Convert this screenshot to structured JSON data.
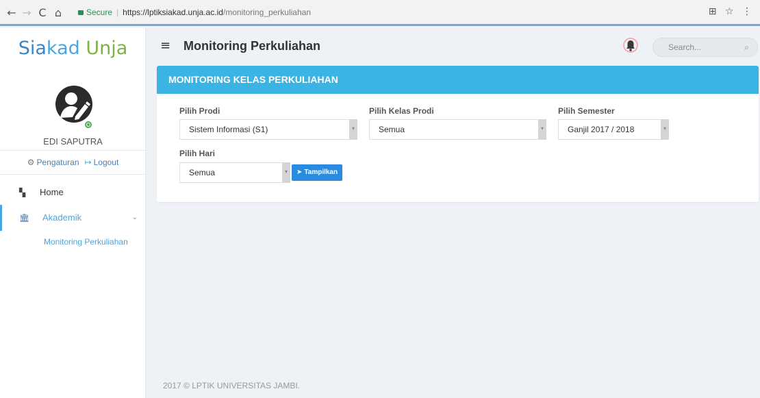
{
  "browser": {
    "secure_label": "Secure",
    "url_host": "https://lptiksiakad.unja.ac.id",
    "url_path": "/monitoring_perkuliahan",
    "back_icon": "←",
    "forward_icon": "→",
    "reload_icon": "C",
    "home_icon": "⌂",
    "translate_icon": "⊞",
    "star_icon": "☆",
    "menu_icon": "⋮"
  },
  "brand": {
    "part1": "Sia",
    "part2": "kad ",
    "part3": "Unja"
  },
  "user": {
    "name": "EDI SAPUTRA",
    "settings_label": "Pengaturan",
    "logout_label": "Logout"
  },
  "sidebar": {
    "items": [
      {
        "label": "Home",
        "icon": "grid-icon"
      },
      {
        "label": "Akademik",
        "icon": "institution-icon"
      }
    ],
    "submenu": [
      "Monitoring Perkuliahan"
    ]
  },
  "header": {
    "title": "Monitoring Perkuliahan",
    "search_placeholder": "Search..."
  },
  "panel": {
    "title": "MONITORING KELAS PERKULIAHAN",
    "fields": {
      "prodi": {
        "label": "Pilih Prodi",
        "value": "Sistem Informasi (S1)"
      },
      "kelas": {
        "label": "Pilih Kelas Prodi",
        "value": "Semua"
      },
      "semester": {
        "label": "Pilih Semester",
        "value": "Ganjil 2017 / 2018"
      },
      "hari": {
        "label": "Pilih Hari",
        "value": "Semua"
      }
    },
    "button_label": "Tampilkan"
  },
  "footer": "2017 © LPTIK UNIVERSITAS JAMBI.",
  "colors": {
    "header_bar": "#3bb3e3",
    "accent": "#4aa6e0",
    "button": "#2a8ae0",
    "online": "#4caf50"
  }
}
